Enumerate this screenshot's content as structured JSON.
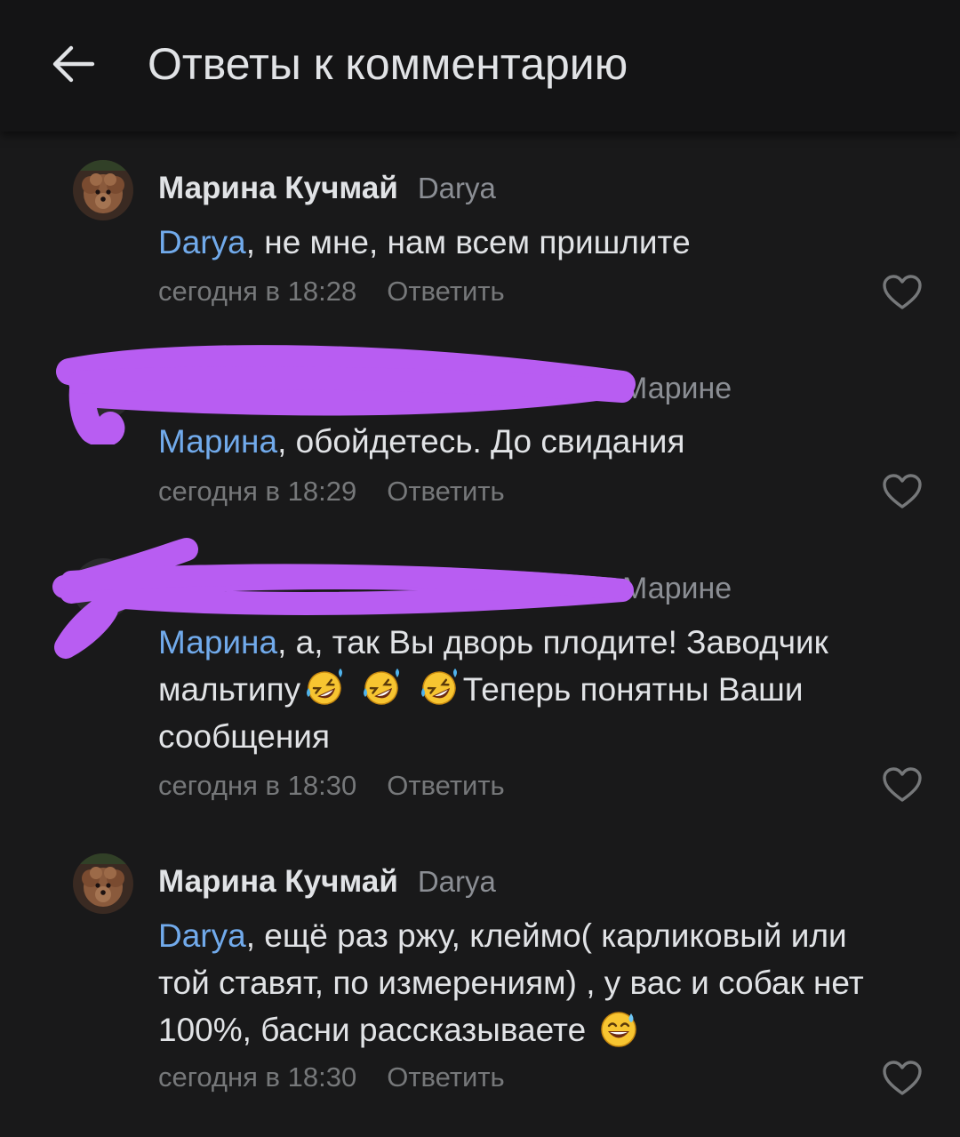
{
  "header": {
    "title": "Ответы к комментарию",
    "back_icon": "arrow-left-icon"
  },
  "colors": {
    "background": "#19191a",
    "header_bg": "#141415",
    "text": "#e1e3e6",
    "secondary": "#76787a",
    "mention": "#71aaeb",
    "redaction": "#b85df2"
  },
  "comments": [
    {
      "author": "Марина Кучмай",
      "reply_to": "Darya",
      "mention": "Darya",
      "text": ", не мне, нам всем пришлите",
      "time": "сегодня в 18:28",
      "reply_label": "Ответить",
      "like_icon": "heart-outline-icon"
    },
    {
      "author_redacted": true,
      "reply_to": "Марине",
      "mention": "Марина",
      "text": ", обойдетесь. До свидания",
      "time": "сегодня в 18:29",
      "reply_label": "Ответить",
      "like_icon": "heart-outline-icon"
    },
    {
      "author_redacted": true,
      "reply_to": "Марине",
      "mention": "Марина",
      "text_part1": ", а, так Вы дворь плодите! Заводчик мальтипу",
      "emoji": "rofl-emoji",
      "text_part2": "Теперь понятны Ваши сообщения",
      "time": "сегодня в 18:30",
      "reply_label": "Ответить",
      "like_icon": "heart-outline-icon"
    },
    {
      "author": "Марина Кучмай",
      "reply_to": "Darya",
      "mention": "Darya",
      "text": ", ещё раз ржу, клеймо( карликовый или той ставят, по измерениям) , у вас и собак нет 100%, басни рассказываете",
      "emoji": "grinning-sweat-emoji",
      "time": "сегодня в 18:30",
      "reply_label": "Ответить",
      "like_icon": "heart-outline-icon"
    }
  ]
}
